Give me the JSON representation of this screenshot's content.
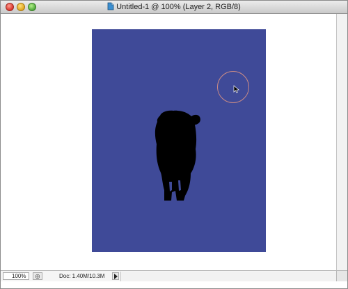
{
  "window": {
    "title": "Untitled-1 @ 100% (Layer 2, RGB/8)",
    "controls": [
      "close",
      "minimize",
      "zoom"
    ]
  },
  "canvas": {
    "background_color": "#3f4a98",
    "subject": "cow-silhouette",
    "brush_cursor_color": "#c88a86"
  },
  "statusbar": {
    "zoom": "100%",
    "doc_info": "Doc: 1.40M/10.3M"
  },
  "icons": {
    "document": "photoshop-document-icon",
    "status": "status-info-icon",
    "menu": "triangle-right-icon"
  }
}
